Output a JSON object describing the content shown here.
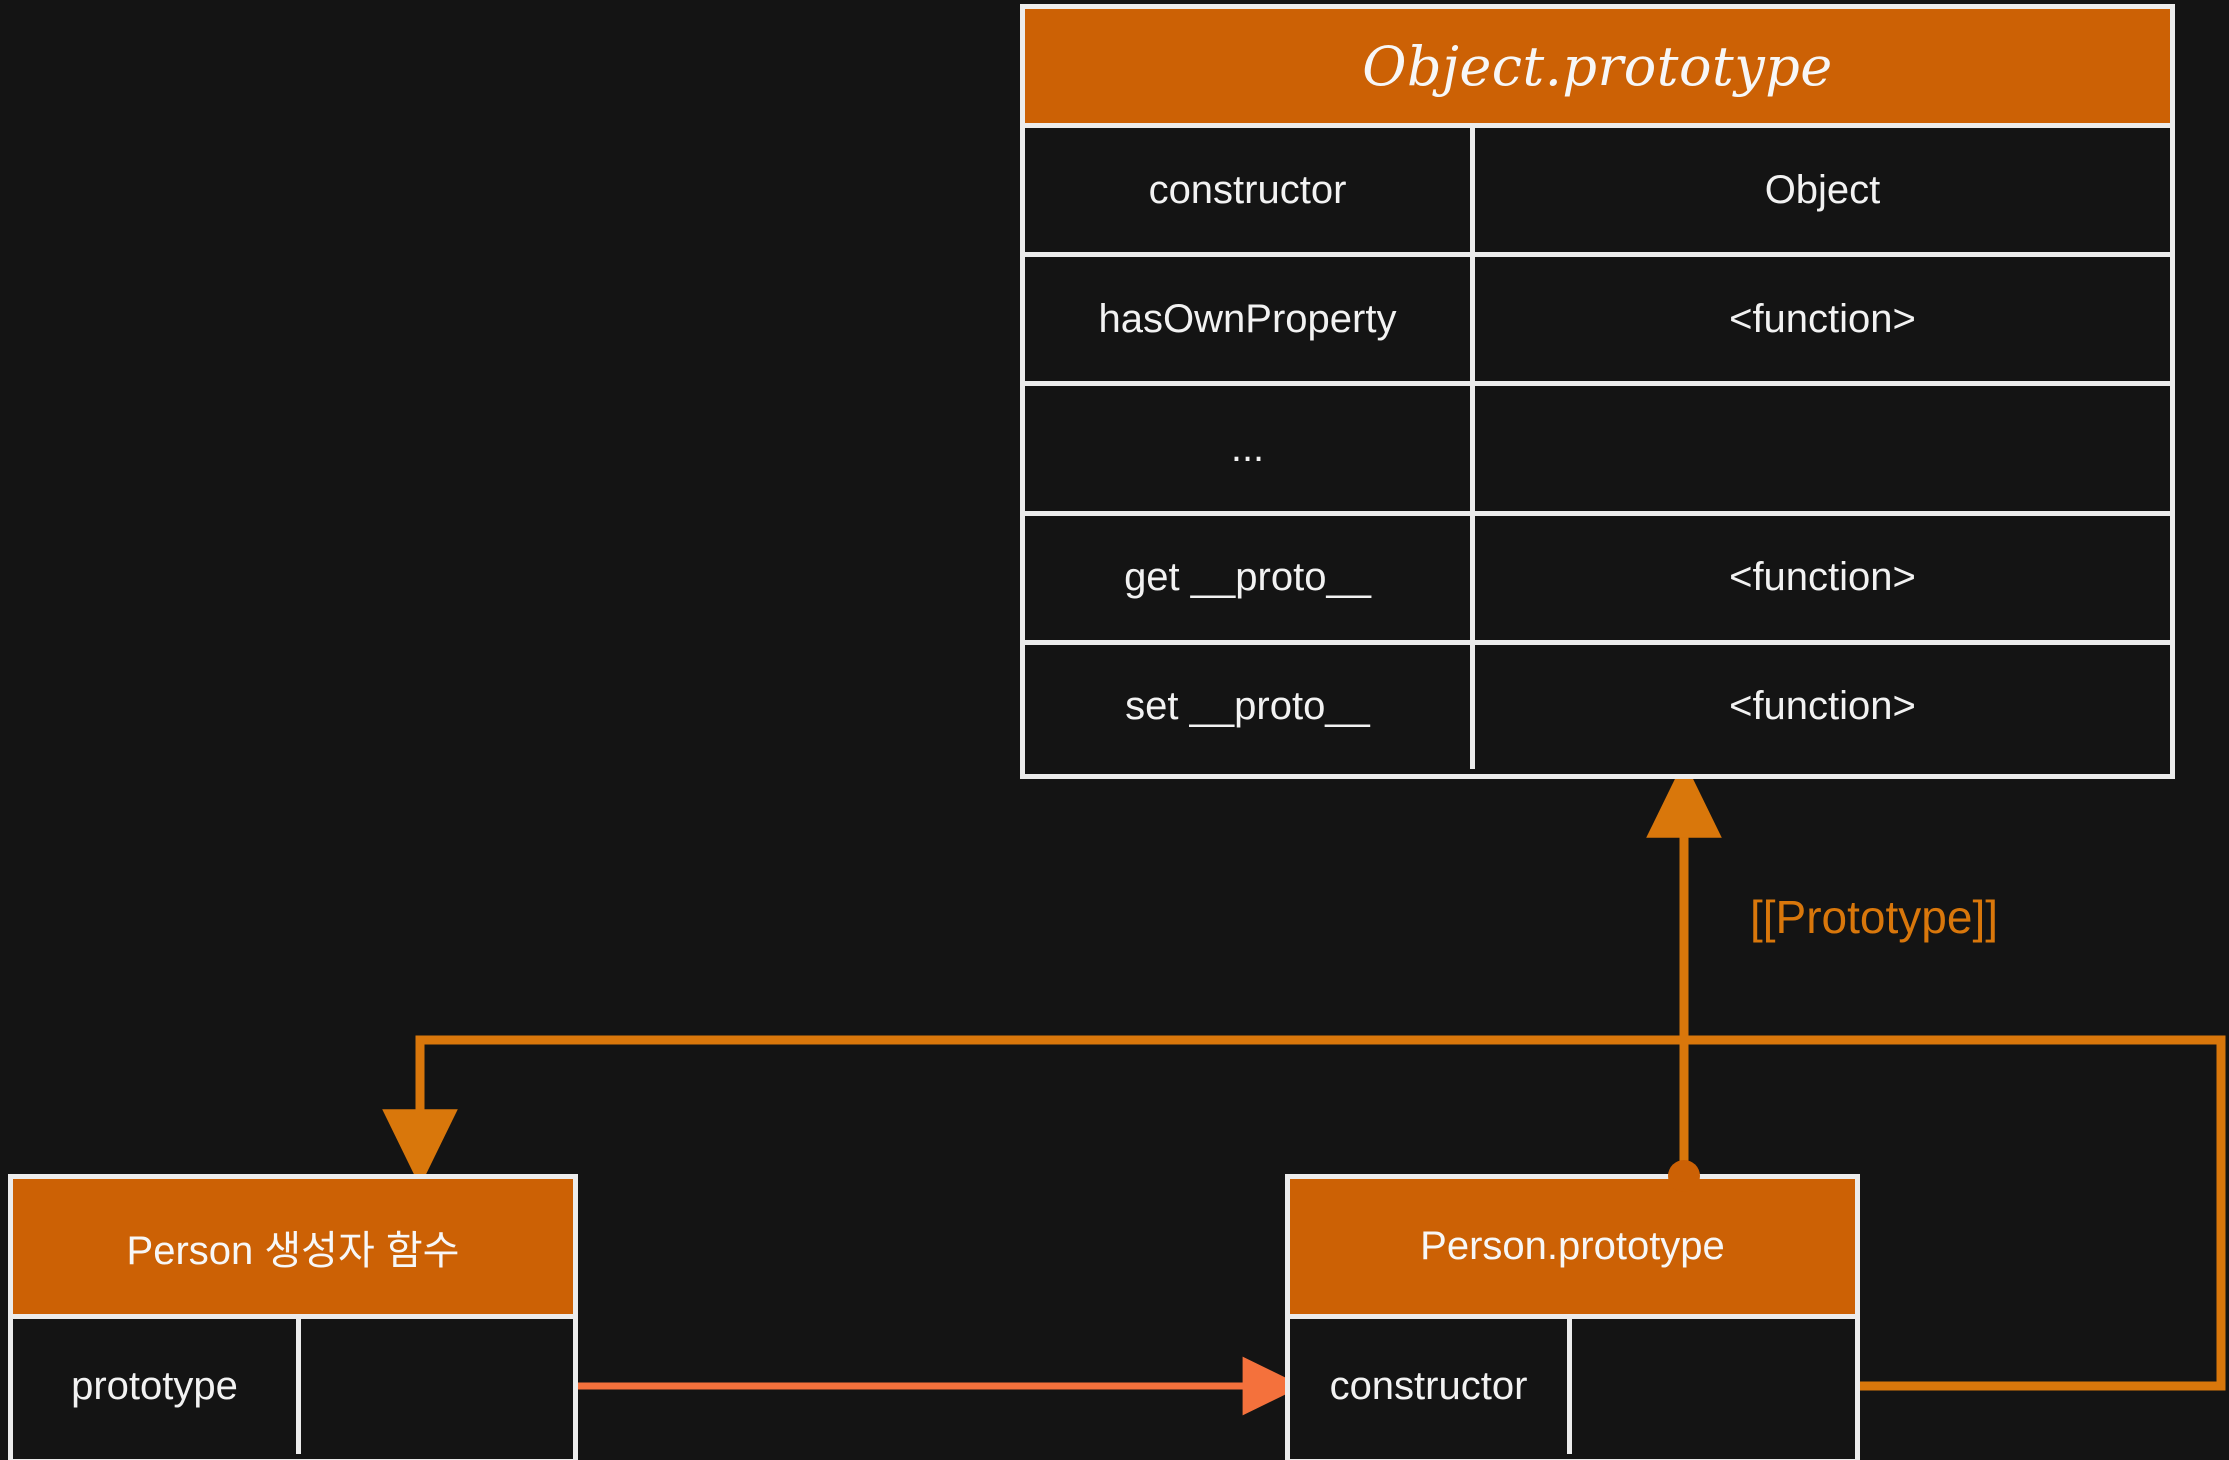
{
  "canvas": {
    "background": "#141414",
    "accent_orange": "#cc6105",
    "link_orange": "#d9770b",
    "link_coral": "#f4713c",
    "border_white": "#ececec",
    "text_white": "#f2f2f2"
  },
  "object_prototype": {
    "title": "Object.prototype",
    "rows": [
      {
        "key": "constructor",
        "value": "Object"
      },
      {
        "key": "hasOwnProperty",
        "value": "<function>"
      },
      {
        "key": "...",
        "value": ""
      },
      {
        "key": "get __proto__",
        "value": "<function>"
      },
      {
        "key": "set __proto__",
        "value": "<function>"
      }
    ]
  },
  "person_constructor": {
    "title": "Person 생성자 함수",
    "slot_label": "prototype",
    "slot_value": ""
  },
  "person_prototype": {
    "title": "Person.prototype",
    "slot_label": "constructor",
    "slot_value": ""
  },
  "edges": {
    "prototype_internal_label": "[[Prototype]]"
  }
}
